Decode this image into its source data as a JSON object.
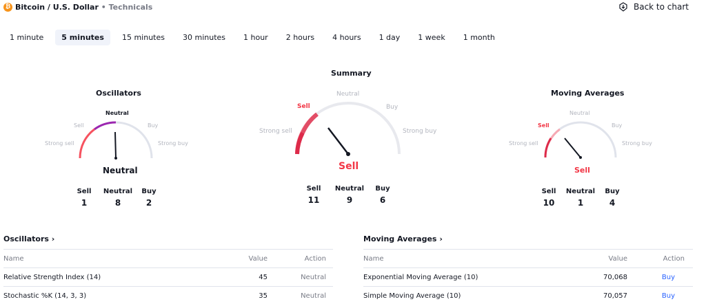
{
  "header": {
    "coin_glyph": "₿",
    "symbol": "Bitcoin / U.S. Dollar",
    "separator": "•",
    "section": "Technicals",
    "back_label": "Back to chart"
  },
  "tabs": [
    {
      "label": "1 minute",
      "active": false
    },
    {
      "label": "5 minutes",
      "active": true
    },
    {
      "label": "15 minutes",
      "active": false
    },
    {
      "label": "30 minutes",
      "active": false
    },
    {
      "label": "1 hour",
      "active": false
    },
    {
      "label": "2 hours",
      "active": false
    },
    {
      "label": "4 hours",
      "active": false
    },
    {
      "label": "1 day",
      "active": false
    },
    {
      "label": "1 week",
      "active": false
    },
    {
      "label": "1 month",
      "active": false
    }
  ],
  "gauge_labels": {
    "strong_sell": "Strong sell",
    "sell": "Sell",
    "neutral": "Neutral",
    "buy": "Buy",
    "strong_buy": "Strong buy"
  },
  "oscillators_gauge": {
    "title": "Oscillators",
    "result": "Neutral",
    "counts": {
      "sell_label": "Sell",
      "sell": "1",
      "neutral_label": "Neutral",
      "neutral": "8",
      "buy_label": "Buy",
      "buy": "2"
    }
  },
  "summary_gauge": {
    "title": "Summary",
    "result": "Sell",
    "counts": {
      "sell_label": "Sell",
      "sell": "11",
      "neutral_label": "Neutral",
      "neutral": "9",
      "buy_label": "Buy",
      "buy": "6"
    }
  },
  "ma_gauge": {
    "title": "Moving Averages",
    "result": "Sell",
    "counts": {
      "sell_label": "Sell",
      "sell": "10",
      "neutral_label": "Neutral",
      "neutral": "1",
      "buy_label": "Buy",
      "buy": "4"
    }
  },
  "colors": {
    "sell": "#f23645",
    "neutral_arc": "#9c27b0",
    "buy_link": "#2962ff",
    "active_tab_bg": "#f0f3fa",
    "gauge_track": "#e0e3eb"
  },
  "oscillators_table": {
    "title": "Oscillators",
    "chevron": "›",
    "headers": {
      "name": "Name",
      "value": "Value",
      "action": "Action"
    },
    "rows": [
      {
        "name": "Relative Strength Index (14)",
        "value": "45",
        "action": "Neutral"
      },
      {
        "name": "Stochastic %K (14, 3, 3)",
        "value": "35",
        "action": "Neutral"
      }
    ]
  },
  "ma_table": {
    "title": "Moving Averages",
    "chevron": "›",
    "headers": {
      "name": "Name",
      "value": "Value",
      "action": "Action"
    },
    "rows": [
      {
        "name": "Exponential Moving Average (10)",
        "value": "70,068",
        "action": "Buy"
      },
      {
        "name": "Simple Moving Average (10)",
        "value": "70,057",
        "action": "Buy"
      }
    ]
  }
}
